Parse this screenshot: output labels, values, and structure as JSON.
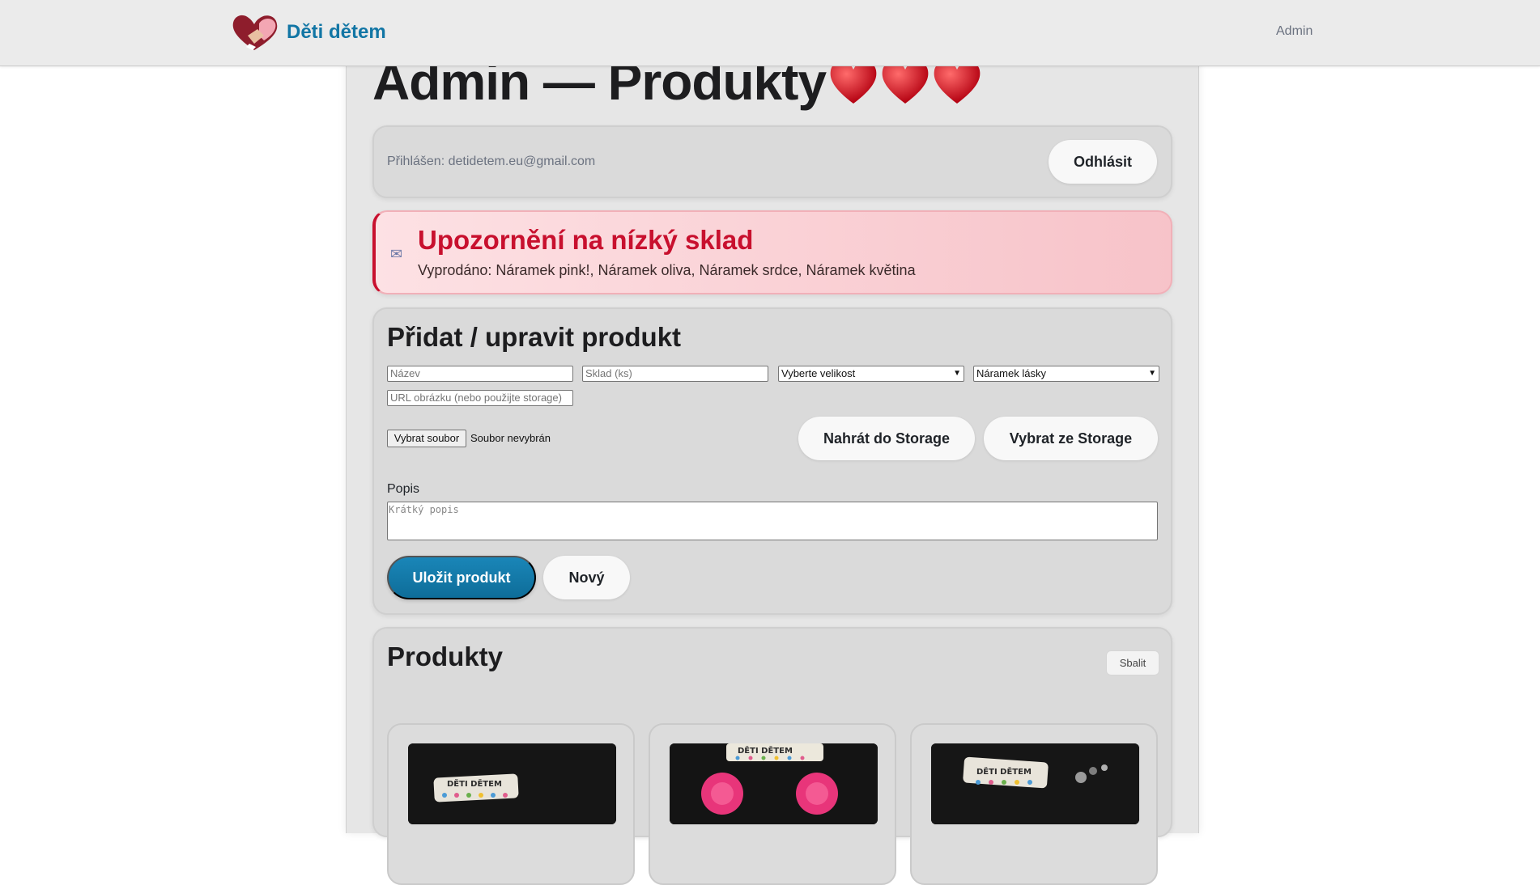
{
  "nav": {
    "brand": "Děti dětem",
    "admin_link": "Admin"
  },
  "page": {
    "title": "Admin — Produkty"
  },
  "session": {
    "logged_in_text": "Přihlášen: detidetem.eu@gmail.com",
    "logout_label": "Odhlásit"
  },
  "alert": {
    "title": "Upozornění na nízký sklad",
    "text": "Vyprodáno: Náramek pink!, Náramek oliva, Náramek srdce, Náramek květina"
  },
  "form": {
    "title": "Přidat / upravit produkt",
    "name_placeholder": "Název",
    "stock_placeholder": "Sklad (ks)",
    "size_selected": "Vyberte velikost",
    "category_selected": "Náramek lásky",
    "image_url_placeholder": "URL obrázku (nebo použijte storage)",
    "file_button": "Vybrat soubor",
    "file_status": "Soubor nevybrán",
    "upload_label": "Nahrát do Storage",
    "pick_label": "Vybrat ze Storage",
    "description_label": "Popis",
    "description_placeholder": "Krátký popis",
    "save_label": "Uložit produkt",
    "new_label": "Nový"
  },
  "products": {
    "title": "Produkty",
    "collapse_label": "Sbalit",
    "tile_label": "DĚTI DĚTEM"
  },
  "colors": {
    "brand": "#1276a5",
    "alert": "#c8102e",
    "primary_button": "#0e6d99"
  }
}
